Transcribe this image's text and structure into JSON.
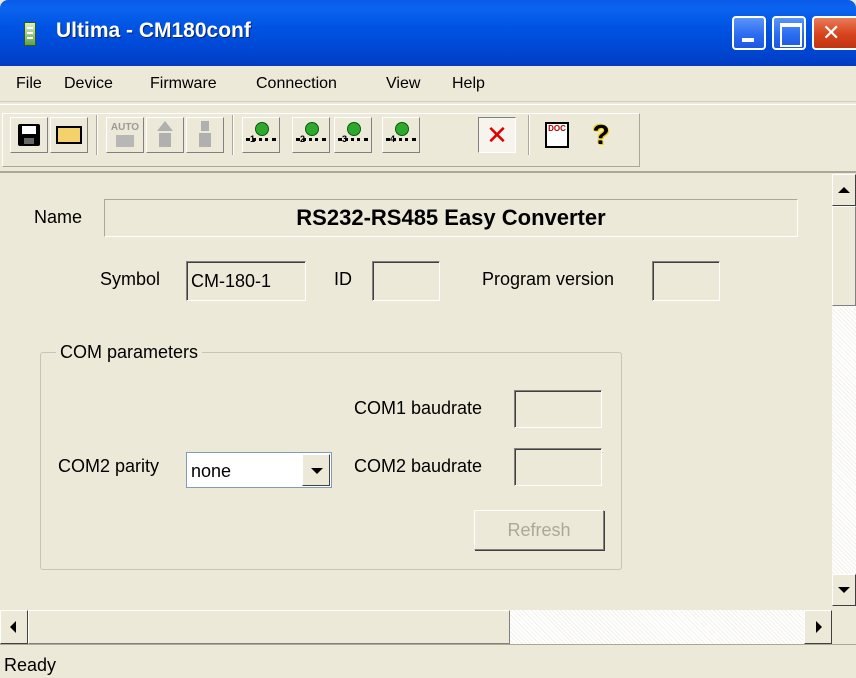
{
  "window": {
    "title": "Ultima - CM180conf",
    "app_icon": "device-icon"
  },
  "menu": [
    "File",
    "Device",
    "Firmware",
    "Connection",
    "View",
    "Help"
  ],
  "toolbar": {
    "icons": [
      "save-icon",
      "open-folder-icon",
      "auto-icon",
      "upload-icon",
      "download-icon",
      "connect-1-icon",
      "connect-2-icon",
      "connect-3-icon",
      "connect-4-icon",
      "disconnect-icon",
      "doc-icon",
      "help-icon"
    ],
    "auto_text": "AUTO",
    "doc_text": "DOC",
    "connect_numbers": [
      "1",
      "2",
      "3",
      "4"
    ]
  },
  "form": {
    "name_label": "Name",
    "name_value": "RS232-RS485 Easy Converter",
    "symbol_label": "Symbol",
    "symbol_value": "CM-180-1",
    "id_label": "ID",
    "id_value": "",
    "program_version_label": "Program version",
    "program_version_value": "",
    "group_title": "COM parameters",
    "com1_baud_label": "COM1 baudrate",
    "com1_baud_value": "",
    "com2_parity_label": "COM2 parity",
    "com2_parity_value": "none",
    "com2_baud_label": "COM2 baudrate",
    "com2_baud_value": "",
    "refresh_label": "Refresh"
  },
  "status": {
    "text": "Ready"
  },
  "colors": {
    "title_bar": "#0054e3",
    "dialog_bg": "#ece9d8",
    "close_button": "#d6431c"
  }
}
